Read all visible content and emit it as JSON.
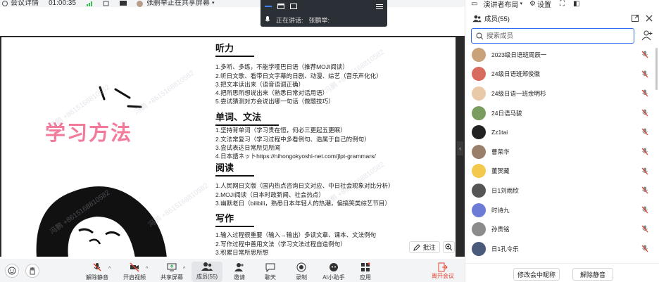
{
  "topbar": {
    "meeting_info": "会议详情",
    "duration": "01:00:35",
    "sharing_status": "张鹏举正在共享屏幕",
    "layout_label": "演讲者布局",
    "settings_label": "设置"
  },
  "sharebar": {
    "speaking_label": "正在讲话:",
    "speaker_name": "张鹏举:"
  },
  "slide": {
    "big_title": "学习方法",
    "sections": [
      {
        "heading": "听力",
        "lines": [
          "1.多听、多练，不能学哑巴日语（推荐MOJI阅读）",
          "2.听日文歌、看带日文字幕的日剧、动漫、综艺（音乐声化化）",
          "3.把文本读出来（语音语调正确）",
          "4.把所思所想说出来（熟悉日常对话用语）",
          "5.尝试猜测对方会说出哪一句话（做题技巧）"
        ]
      },
      {
        "heading": "单词、文法",
        "lines": [
          "1.坚持背单词（学习贵在恒，何必三更起五更眠）",
          "2.文法常复习（学习过程中多看例句、造属于自己的例句）",
          "3.尝试表达日常所见所闻",
          "4.日本語ネットhttps://nihongokyoshi-net.com/jlpt-grammars/"
        ]
      },
      {
        "heading": "阅读",
        "lines": [
          "1.人民网日文版（国内热点咨询日文对应、中日社会现象对比分析）",
          "2.MOJI阅读（日本时政新闻、社会热点）",
          "3.幽默老日（bilibili，熟悉日本年轻人的热潮，偏搞笑类综艺节目）"
        ]
      },
      {
        "heading": "写作",
        "lines": [
          "1.输入过程很重要（输入→输出）多读文章、课本、文法例句",
          "2.写作过程中善用文法（学习文法过程自造例句）",
          "3.积累日常所思所想"
        ]
      }
    ],
    "watermark": "冯鹏 +8615168810582",
    "annotate_label": "批注"
  },
  "toolbar": {
    "items": [
      {
        "label": "解除静音"
      },
      {
        "label": "开启视频"
      },
      {
        "label": "共享屏幕"
      },
      {
        "label": "成员(55)"
      },
      {
        "label": "邀请"
      },
      {
        "label": "聊天"
      },
      {
        "label": "录制"
      },
      {
        "label": "AI小助手"
      },
      {
        "label": "应用"
      }
    ],
    "leave_label": "离开会议"
  },
  "panel": {
    "title": "成员(55)",
    "search_placeholder": "搜索成员",
    "members": [
      {
        "name": "2023级日语班周辰一",
        "color": "#c9a27a"
      },
      {
        "name": "24级日语班郑俊徽",
        "color": "#d86b5e"
      },
      {
        "name": "24级日语一班余明杉",
        "color": "#e8c9a8"
      },
      {
        "name": "24日语马骏",
        "color": "#7a9c5e"
      },
      {
        "name": "Zz1tai",
        "color": "#222222"
      },
      {
        "name": "曹荣华",
        "color": "#9a7f6a"
      },
      {
        "name": "董贺藏",
        "color": "#f2c94c"
      },
      {
        "name": "日1刘雨欣",
        "color": "#555555"
      },
      {
        "name": "时诗九",
        "color": "#6b7bd6"
      },
      {
        "name": "孙贵铭",
        "color": "#8c8c8c"
      },
      {
        "name": "日1孔令乐",
        "color": "#4a5a7a"
      }
    ],
    "rename_label": "修改会中昵称",
    "unmute_label": "解除静音"
  }
}
